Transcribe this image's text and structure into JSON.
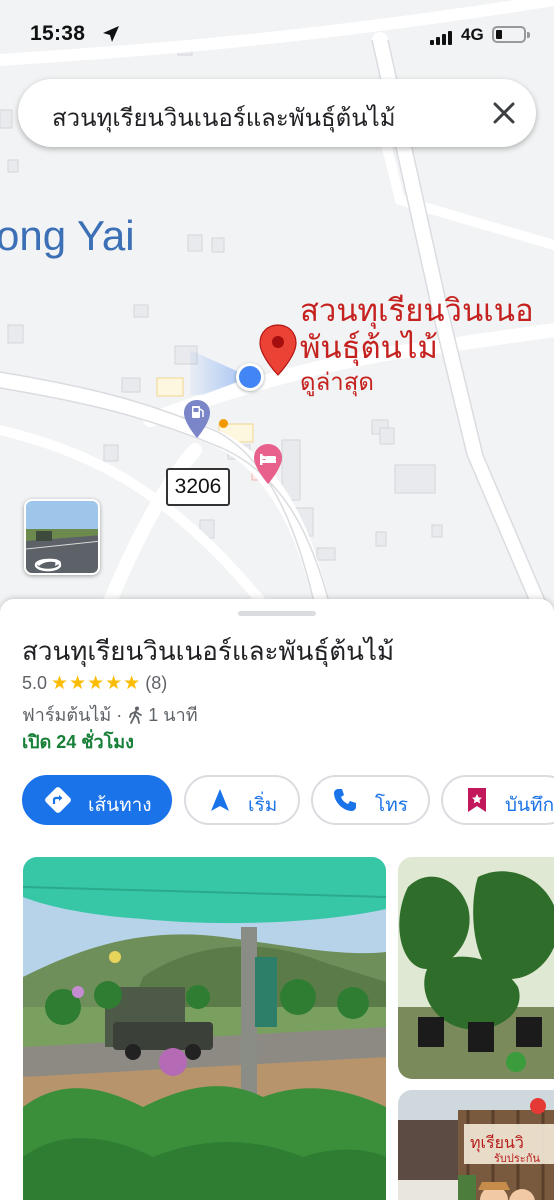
{
  "status_bar": {
    "time": "15:38",
    "network": "4G"
  },
  "search": {
    "query": "สวนทุเรียนวินเนอร์และพันธุ์ต้นไม้"
  },
  "map": {
    "town_label": "ong Yai",
    "place_name_line1": "สวนทุเรียนวินเนอ",
    "place_name_line2": "พันธุ์ต้นไม้",
    "place_status": "ดูล่าสุด",
    "route_shield": "3206",
    "colors": {
      "pin": "#ea4335",
      "label": "#c5221f",
      "my_location": "#4285f4",
      "town": "#3b6fb6"
    }
  },
  "place": {
    "name": "สวนทุเรียนวินเนอร์และพันธุ์ต้นไม้",
    "rating": "5.0",
    "stars": "★★★★★",
    "review_count": "(8)",
    "category": "ฟาร์มต้นไม้ ·",
    "walk_time": "1 นาที",
    "hours": "เปิด 24 ชั่วโมง"
  },
  "actions": {
    "directions": "เส้นทาง",
    "start": "เริ่ม",
    "call": "โทร",
    "save": "บันทึก"
  },
  "photos": {
    "sign_text": "ทุเรียนวิ\nรับประกัน"
  },
  "icons": [
    "location-arrow-icon",
    "close-icon",
    "directions-icon",
    "navigation-icon",
    "phone-icon",
    "bookmark-icon",
    "walking-icon",
    "gas-station-icon",
    "hotel-icon",
    "pin-icon",
    "street-view-icon"
  ]
}
